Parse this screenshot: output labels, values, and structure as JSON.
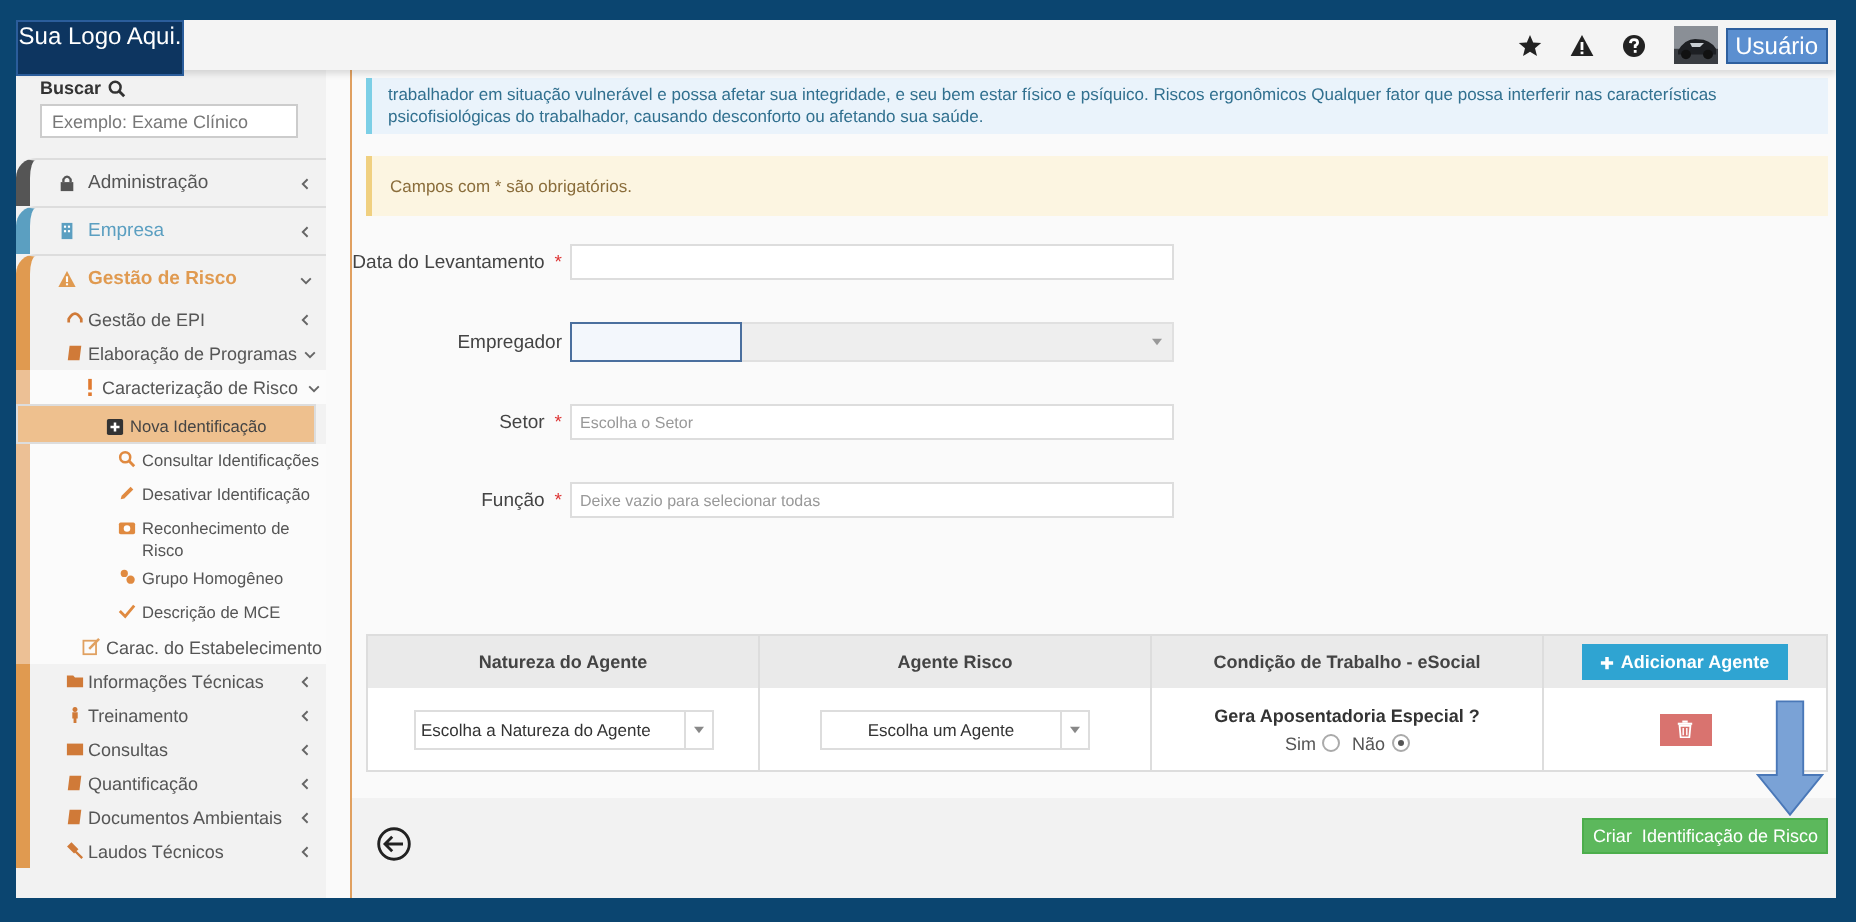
{
  "header": {
    "logo": "Sua Logo Aqui.",
    "user_button": "Usuário"
  },
  "sidebar": {
    "search_label": "Buscar",
    "search_placeholder": "Exemplo: Exame Clínico",
    "items": [
      {
        "label": "Administração",
        "expanded": false,
        "color": "#555555"
      },
      {
        "label": "Empresa",
        "expanded": false,
        "color": "#5b9fc1"
      },
      {
        "label": "Gestão de Risco",
        "expanded": true,
        "color": "#e09a50",
        "children": [
          {
            "label": "Gestão de EPI",
            "expanded": false
          },
          {
            "label": "Elaboração de Programas",
            "expanded": true,
            "children": [
              {
                "label": "Caracterização de Risco",
                "expanded": true,
                "children": [
                  {
                    "label": "Nova Identificação",
                    "selected": true
                  },
                  {
                    "label": "Consultar Identificações",
                    "selected": false
                  },
                  {
                    "label": "Desativar Identificação",
                    "selected": false
                  },
                  {
                    "label": "Reconhecimento de Risco",
                    "selected": false
                  },
                  {
                    "label": "Grupo Homogêneo",
                    "selected": false
                  },
                  {
                    "label": "Descrição de MCE",
                    "selected": false
                  }
                ]
              },
              {
                "label": "Carac. do Estabelecimento"
              }
            ]
          },
          {
            "label": "Informações Técnicas",
            "expanded": false
          },
          {
            "label": "Treinamento",
            "expanded": false
          },
          {
            "label": "Consultas",
            "expanded": false
          },
          {
            "label": "Quantificação",
            "expanded": false
          },
          {
            "label": "Documentos Ambientais",
            "expanded": false
          },
          {
            "label": "Laudos Técnicos",
            "expanded": false
          }
        ]
      }
    ]
  },
  "info_text": "trabalhador em situação vulnerável e possa afetar sua integridade, e seu bem estar físico e psíquico. Riscos ergonômicos Qualquer fator que possa interferir nas características psicofisiológicas do trabalhador, causando desconforto ou afetando sua saúde.",
  "warning_text": "Campos com * são obrigatórios.",
  "required_mark": "*",
  "form": [
    {
      "kind": "input",
      "label": "Data do Levantamento",
      "required": true
    },
    {
      "kind": "select",
      "label": "Empregador",
      "required": false
    },
    {
      "kind": "input",
      "label": "Setor",
      "required": true,
      "placeholder": "Escolha o Setor"
    },
    {
      "kind": "input",
      "label": "Função",
      "required": true,
      "placeholder": "Deixe vazio para selecionar todas"
    }
  ],
  "table": {
    "columns": [
      "Natureza do Agente",
      "Agente Risco",
      "Condição de Trabalho - eSocial"
    ],
    "add_button": "Adicionar Agente",
    "row": {
      "nature_select": "Escolha a Natureza do Agente",
      "agent_select": "Escolha um Agente",
      "question": "Gera Aposentadoria Especial ?",
      "options": [
        {
          "label": "Sim",
          "selected": false
        },
        {
          "label": "Não",
          "selected": true
        }
      ]
    }
  },
  "submit_button": "Criar  Identificação de Risco"
}
